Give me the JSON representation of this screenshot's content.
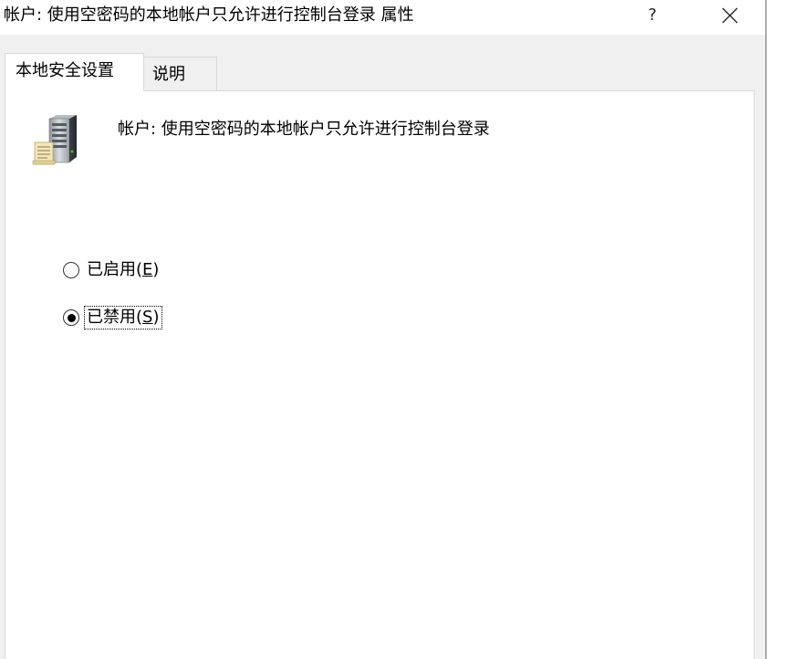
{
  "window": {
    "title": "帐户: 使用空密码的本地帐户只允许进行控制台登录 属性",
    "help_glyph": "?"
  },
  "tabs": [
    {
      "label": "本地安全设置",
      "active": true
    },
    {
      "label": "说明",
      "active": false
    }
  ],
  "policy": {
    "icon": "server-policy-icon",
    "name": "帐户: 使用空密码的本地帐户只允许进行控制台登录"
  },
  "options": [
    {
      "label_main": "已启用(",
      "accel": "E",
      "label_end": ")",
      "selected": false
    },
    {
      "label_main": "已禁用(",
      "accel": "S",
      "label_end": ")",
      "selected": true
    }
  ],
  "colors": {
    "window_bg": "#f0f0f0",
    "panel_bg": "#ffffff",
    "border": "#d9d9d9"
  }
}
